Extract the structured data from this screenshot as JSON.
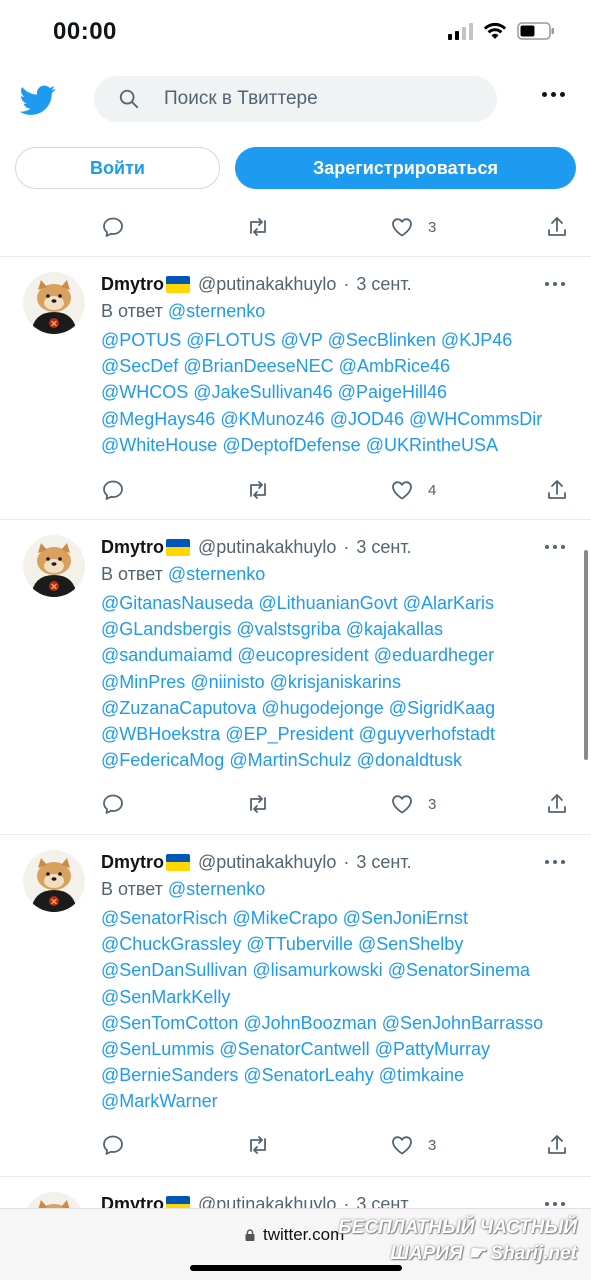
{
  "status": {
    "time": "00:00"
  },
  "header": {
    "search_placeholder": "Поиск в Твиттере"
  },
  "auth": {
    "login": "Войти",
    "signup": "Зарегистрироваться"
  },
  "top_actions": {
    "like_count": "3"
  },
  "tweets": [
    {
      "name": "Dmytro",
      "handle": "@putinakakhuylo",
      "sep": "·",
      "date": "3 сент.",
      "reply_prefix": "В ответ",
      "reply_to": "@sternenko",
      "lines": [
        [
          "@POTUS",
          "@FLOTUS",
          "@VP",
          "@SecBlinken",
          "@KJP46"
        ],
        [
          "@SecDef",
          "@BrianDeeseNEC",
          "@AmbRice46"
        ],
        [
          "@WHCOS",
          "@JakeSullivan46",
          "@PaigeHill46"
        ],
        [
          "@MegHays46",
          "@KMunoz46",
          "@JOD46",
          "@WHCommsDir"
        ],
        [
          "@WhiteHouse",
          "@DeptofDefense",
          "@UKRintheUSA"
        ]
      ],
      "like_count": "4"
    },
    {
      "name": "Dmytro",
      "handle": "@putinakakhuylo",
      "sep": "·",
      "date": "3 сент.",
      "reply_prefix": "В ответ",
      "reply_to": "@sternenko",
      "lines": [
        [
          "@GitanasNauseda",
          "@LithuanianGovt",
          "@AlarKaris"
        ],
        [
          "@GLandsbergis",
          "@valstsgriba",
          "@kajakallas"
        ],
        [
          "@sandumaiamd",
          "@eucopresident",
          "@eduardheger"
        ],
        [
          "@MinPres",
          "@niinisto",
          "@krisjaniskarins"
        ],
        [
          "@ZuzanaCaputova",
          "@hugodejonge",
          "@SigridKaag"
        ],
        [
          "@WBHoekstra",
          "@EP_President",
          "@guyverhofstadt"
        ],
        [
          "@FedericaMog",
          "@MartinSchulz",
          "@donaldtusk"
        ]
      ],
      "like_count": "3"
    },
    {
      "name": "Dmytro",
      "handle": "@putinakakhuylo",
      "sep": "·",
      "date": "3 сент.",
      "reply_prefix": "В ответ",
      "reply_to": "@sternenko",
      "lines": [
        [
          "@SenatorRisch",
          "@MikeCrapo",
          "@SenJoniErnst"
        ],
        [
          "@ChuckGrassley",
          "@TTuberville",
          "@SenShelby"
        ],
        [
          "@SenDanSullivan",
          "@lisamurkowski",
          "@SenatorSinema"
        ],
        [
          "@SenMarkKelly"
        ],
        [
          "@SenTomCotton",
          "@JohnBoozman",
          "@SenJohnBarrasso"
        ],
        [
          "@SenLummis",
          "@SenatorCantwell",
          "@PattyMurray"
        ],
        [
          "@BernieSanders",
          "@SenatorLeahy",
          "@timkaine"
        ],
        [
          "@MarkWarner"
        ]
      ],
      "like_count": "3"
    },
    {
      "name": "Dmytro",
      "handle": "@putinakakhuylo",
      "sep": "·",
      "date": "3 сент."
    }
  ],
  "browser": {
    "url": "twitter.com"
  },
  "watermark": {
    "line1": "БЕСПЛАТНЫЙ ЧАСТНЫЙ",
    "line2": "ШАРИЯ",
    "line3": "Sharij.net"
  },
  "colors": {
    "accent": "#1d9bf0",
    "secondary_text": "#536471"
  }
}
